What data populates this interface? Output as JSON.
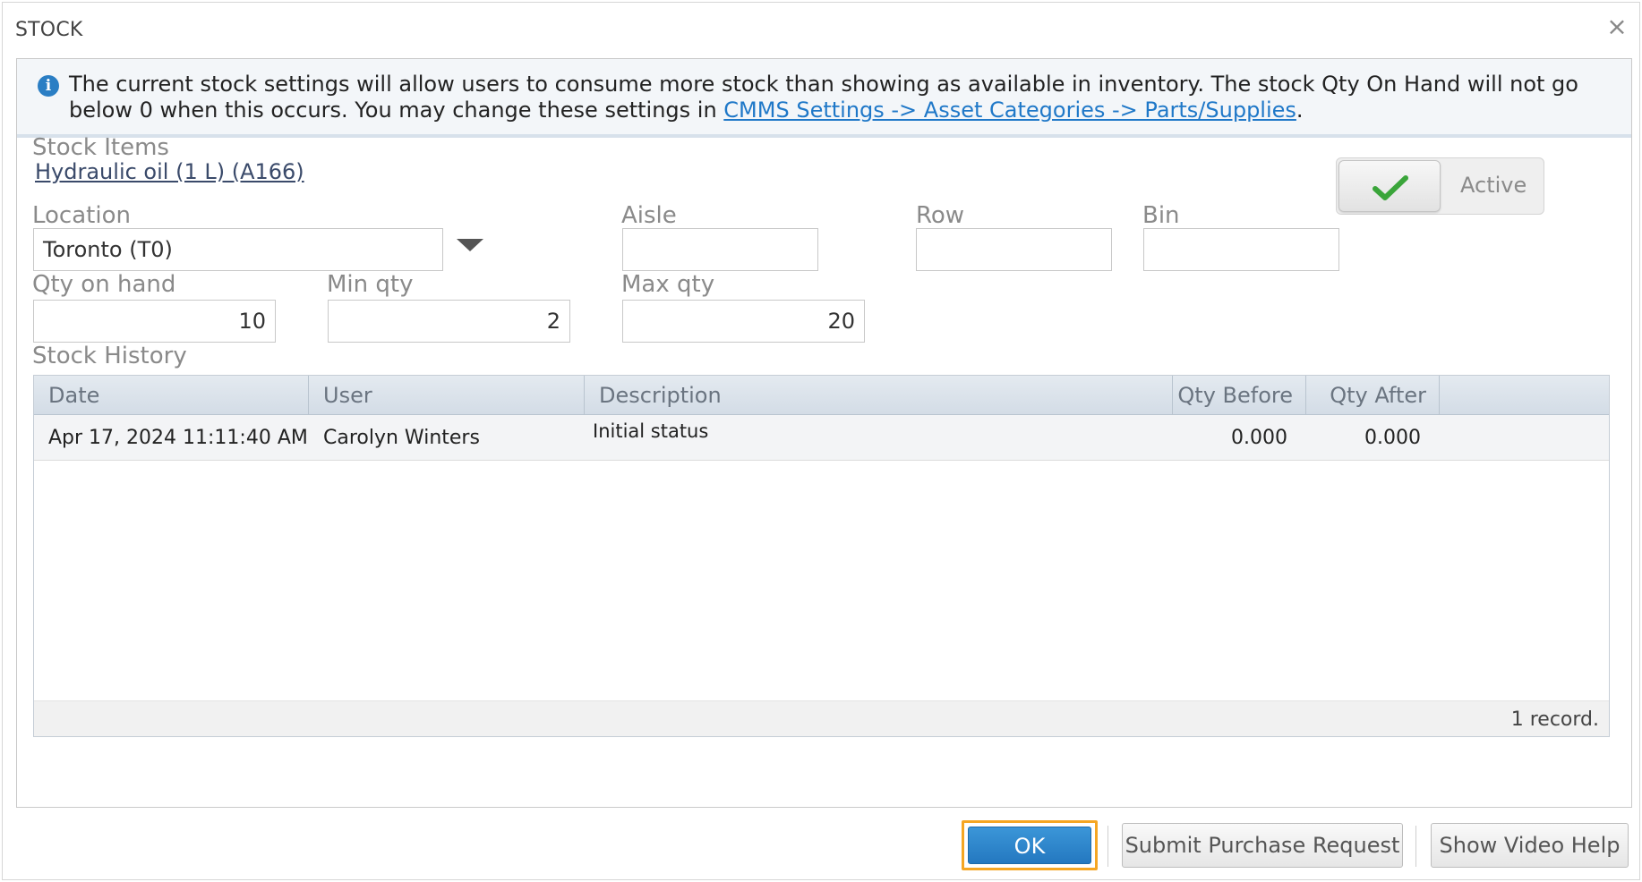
{
  "dialog": {
    "title": "STOCK",
    "close_symbol": "×"
  },
  "notice": {
    "icon": "info-icon",
    "text_before": "The current stock settings will allow users to consume more stock than showing as available in inventory. The stock Qty On Hand will not go below 0 when this occurs. You may change these settings in ",
    "link_text": "CMMS Settings -> Asset Categories -> Parts/Supplies",
    "text_after": "."
  },
  "stock_items": {
    "label": "Stock Items",
    "item_link": "Hydraulic oil (1 L) (A166)"
  },
  "active_toggle": {
    "label": "Active",
    "checked": true,
    "check_color": "#3aa53a"
  },
  "fields": {
    "location": {
      "label": "Location",
      "value": "Toronto (T0)"
    },
    "aisle": {
      "label": "Aisle",
      "value": ""
    },
    "row": {
      "label": "Row",
      "value": ""
    },
    "bin": {
      "label": "Bin",
      "value": ""
    },
    "qty_on_hand": {
      "label": "Qty on hand",
      "value": "10"
    },
    "min_qty": {
      "label": "Min qty",
      "value": "2"
    },
    "max_qty": {
      "label": "Max qty",
      "value": "20"
    }
  },
  "history": {
    "label": "Stock History",
    "columns": [
      "Date",
      "User",
      "Description",
      "Qty Before",
      "Qty After"
    ],
    "rows": [
      {
        "date": "Apr 17, 2024 11:11:40 AM",
        "user": "Carolyn Winters",
        "description": "Initial status",
        "qty_before": "0.000",
        "qty_after": "0.000"
      }
    ],
    "record_count": "1 record."
  },
  "buttons": {
    "ok": "OK",
    "submit_purchase_request": "Submit Purchase Request",
    "show_video_help": "Show Video Help",
    "ok_color": "#2a80c8",
    "focus_color": "#f5a623"
  }
}
